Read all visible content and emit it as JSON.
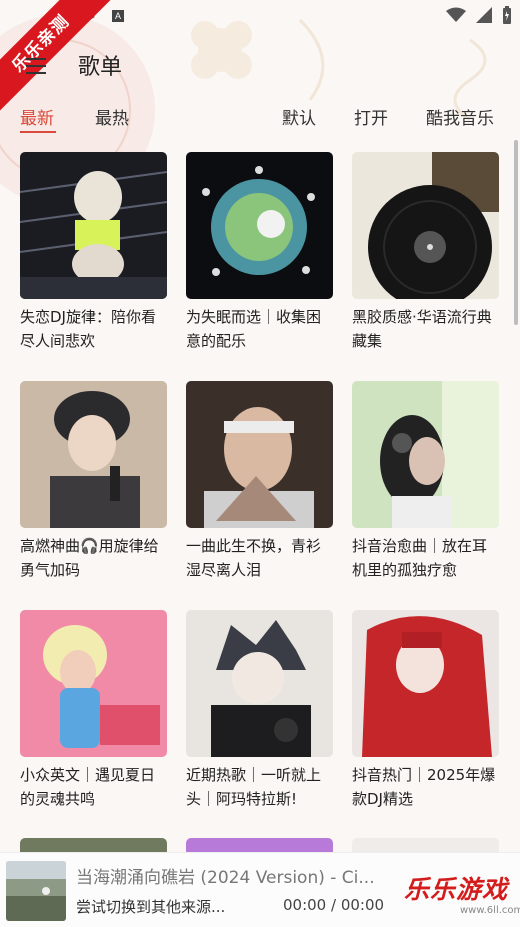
{
  "app": {
    "ribbon": "乐乐亲测",
    "title": "歌单"
  },
  "tabs_left": [
    "最新",
    "最热"
  ],
  "tabs_right": [
    "默认",
    "打开",
    "酷我音乐"
  ],
  "playlists": [
    {
      "title": "失恋DJ旋律：陪你看尽人间悲欢"
    },
    {
      "title": "为失眠而选｜收集困意的配乐"
    },
    {
      "title": "黑胶质感·华语流行典藏集"
    },
    {
      "title": "高燃神曲🎧用旋律给勇气加码"
    },
    {
      "title": "一曲此生不换，青衫湿尽离人泪"
    },
    {
      "title": "抖音治愈曲｜放在耳机里的孤独疗愈"
    },
    {
      "title": "小众英文｜遇见夏日的灵魂共鸣"
    },
    {
      "title": "近期热歌｜一听就上头｜阿玛特拉斯!"
    },
    {
      "title": "抖音热门｜2025年爆款DJ精选"
    }
  ],
  "player": {
    "title": "当海潮涌向礁岩 (2024 Version) - Ci...",
    "subtitle": "尝试切换到其他来源...",
    "time": "00:00 / 00:00"
  },
  "watermark": {
    "text": "乐乐游戏",
    "url": "www.6ll.com"
  },
  "colors": {
    "accent": "#d94a3c",
    "ribbon": "#d8181e"
  },
  "icons": [
    "menu-icon",
    "wifi-icon",
    "signal-icon",
    "battery-icon",
    "play-icon",
    "notification-a-icon"
  ]
}
